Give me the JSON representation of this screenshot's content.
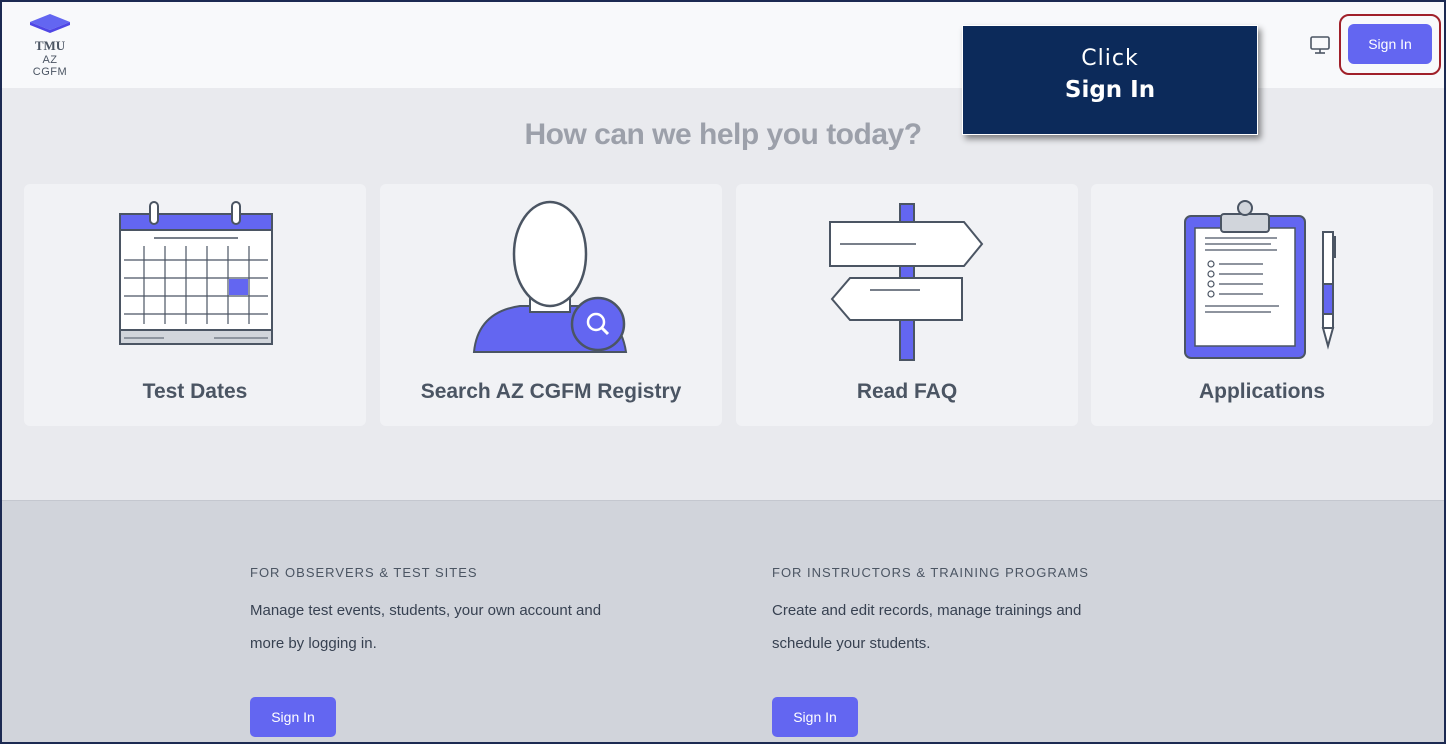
{
  "logo": {
    "line1": "TMU",
    "line2": "AZ CGFM"
  },
  "header": {
    "signin_label": "Sign In",
    "monitor_icon": "monitor-icon"
  },
  "callout": {
    "line1": "Click",
    "line2": "Sign In"
  },
  "hero": {
    "title": "How can we help you today?",
    "cards": [
      {
        "label": "Test Dates",
        "icon": "calendar-icon"
      },
      {
        "label": "Search AZ CGFM Registry",
        "icon": "person-search-icon"
      },
      {
        "label": "Read FAQ",
        "icon": "signpost-icon"
      },
      {
        "label": "Applications",
        "icon": "clipboard-icon"
      }
    ]
  },
  "footer": {
    "observers": {
      "heading": "FOR OBSERVERS & TEST SITES",
      "line1": "Manage test events, students, your own account and",
      "line2": "more by logging in.",
      "button": "Sign In"
    },
    "instructors": {
      "heading": "FOR INSTRUCTORS & TRAINING PROGRAMS",
      "line1": "Create and edit records, manage trainings and",
      "line2": "schedule your students.",
      "button": "Sign In"
    }
  },
  "colors": {
    "accent": "#6366f1",
    "callout_bg": "#0c2a5a",
    "highlight": "#a0202a"
  }
}
